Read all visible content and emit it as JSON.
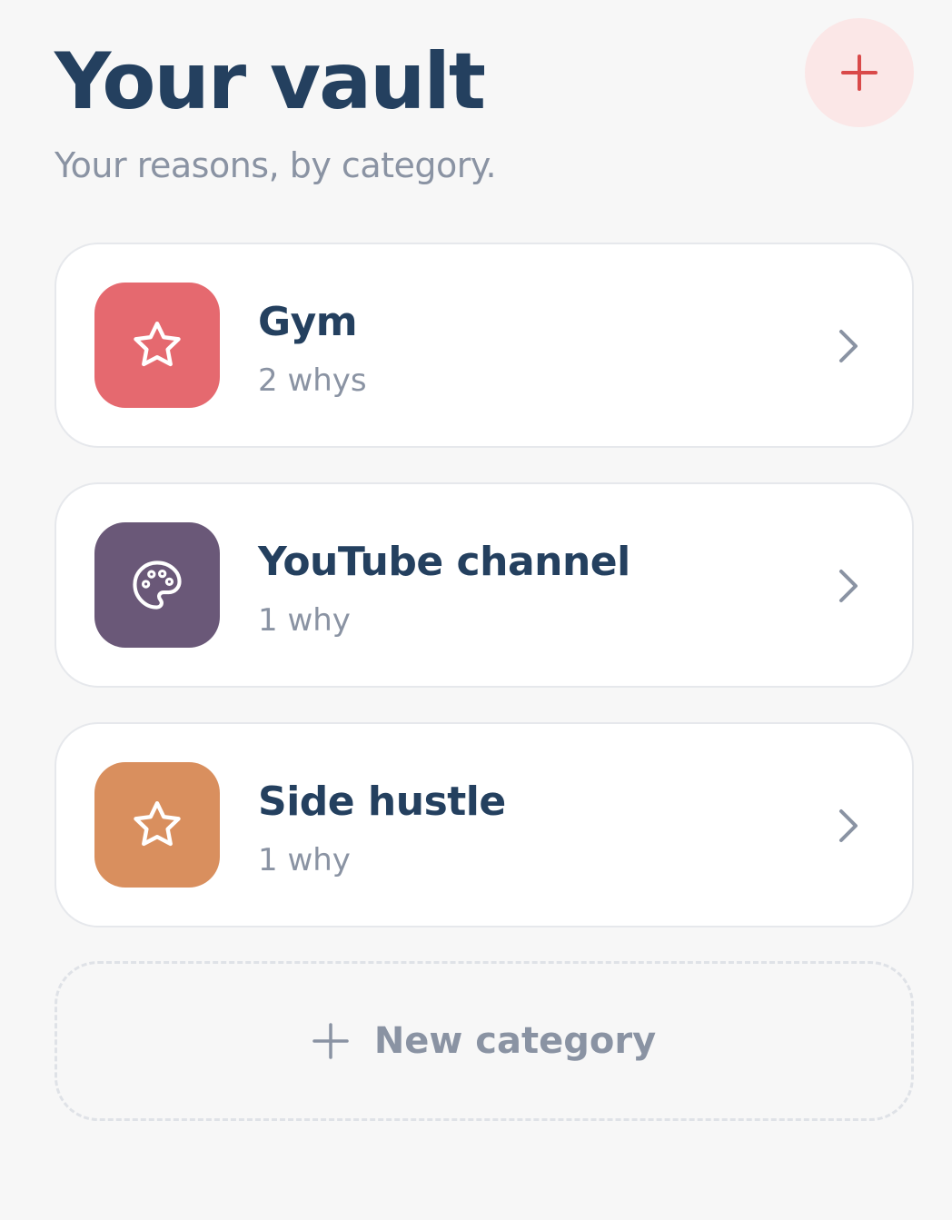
{
  "header": {
    "title": "Your vault",
    "subtitle": "Your reasons, by category.",
    "add_button_icon": "plus-icon",
    "add_button_color": "#d94a4a",
    "add_button_bg": "#fbe7e7"
  },
  "categories": [
    {
      "name": "Gym",
      "count_label": "2 whys",
      "icon": "star-icon",
      "color": "#e5696f"
    },
    {
      "name": "YouTube channel",
      "count_label": "1 why",
      "icon": "palette-icon",
      "color": "#6a5878"
    },
    {
      "name": "Side hustle",
      "count_label": "1 why",
      "icon": "star-icon",
      "color": "#d98f5e"
    }
  ],
  "new_category": {
    "label": "New category",
    "icon": "plus-icon"
  },
  "colors": {
    "background": "#f7f7f7",
    "title": "#24405f",
    "muted_text": "#8a93a3",
    "card_border": "#e6e8ec"
  }
}
